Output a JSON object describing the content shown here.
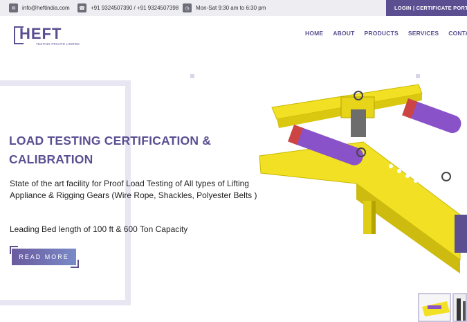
{
  "topbar": {
    "email": "info@heftindia.com",
    "phone": "+91 9324507390 / +91 9324507398",
    "hours": "Mon-Sat 9:30 am to 6:30 pm",
    "login_label": "LOGIN | CERTIFICATE PORTAL",
    "icons": [
      "envelope-icon",
      "phone-icon",
      "clock-icon"
    ]
  },
  "logo": {
    "text": "HEFT",
    "subtitle": "TESTING PRIVATE LIMITED"
  },
  "nav": {
    "items": [
      "HOME",
      "ABOUT",
      "PRODUCTS",
      "SERVICES",
      "CONTACT"
    ]
  },
  "hero": {
    "title": "LOAD TESTING CERTIFICATION & CALIBRATION",
    "description": "State of the art facility for Proof Load Testing of All types of Lifting Appliance & Rigging Gears (Wire Rope, Shackles, Polyester Belts )",
    "capacity": "Leading Bed length of 100 ft & 600 Ton Capacity",
    "button_label": "READ MORE"
  },
  "colors": {
    "brand": "#5b4f92",
    "topbar_bg": "#ededf2",
    "frame": "#e8e6f2",
    "product_yellow": "#f2e025",
    "cylinder_purple": "#8a52c8"
  }
}
